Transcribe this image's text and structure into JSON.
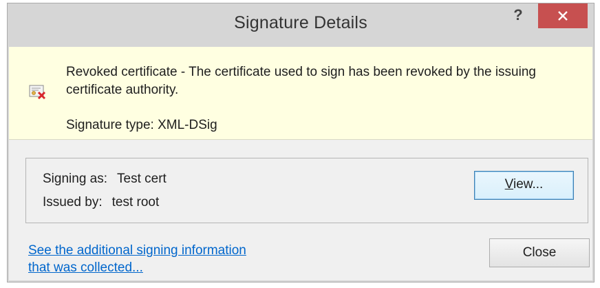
{
  "window": {
    "title": "Signature Details",
    "help_label": "?"
  },
  "banner": {
    "icon": "revoked-certificate-icon",
    "status_message": "Revoked certificate - The certificate used to sign has been revoked by the issuing certificate authority.",
    "signature_type": "Signature type: XML-DSig"
  },
  "details": {
    "signing_as_label": "Signing as:",
    "signing_as_value": "Test cert",
    "issued_by_label": "Issued by:",
    "issued_by_value": "test root",
    "view_button_mnemonic": "V",
    "view_button_rest": "iew..."
  },
  "footer": {
    "link_line1": "See the additional signing information",
    "link_line2": "that was collected...",
    "close_label": "Close"
  },
  "colors": {
    "title_close_button": "#c75050",
    "banner_background": "#ffffe1",
    "link": "#0066cc"
  }
}
